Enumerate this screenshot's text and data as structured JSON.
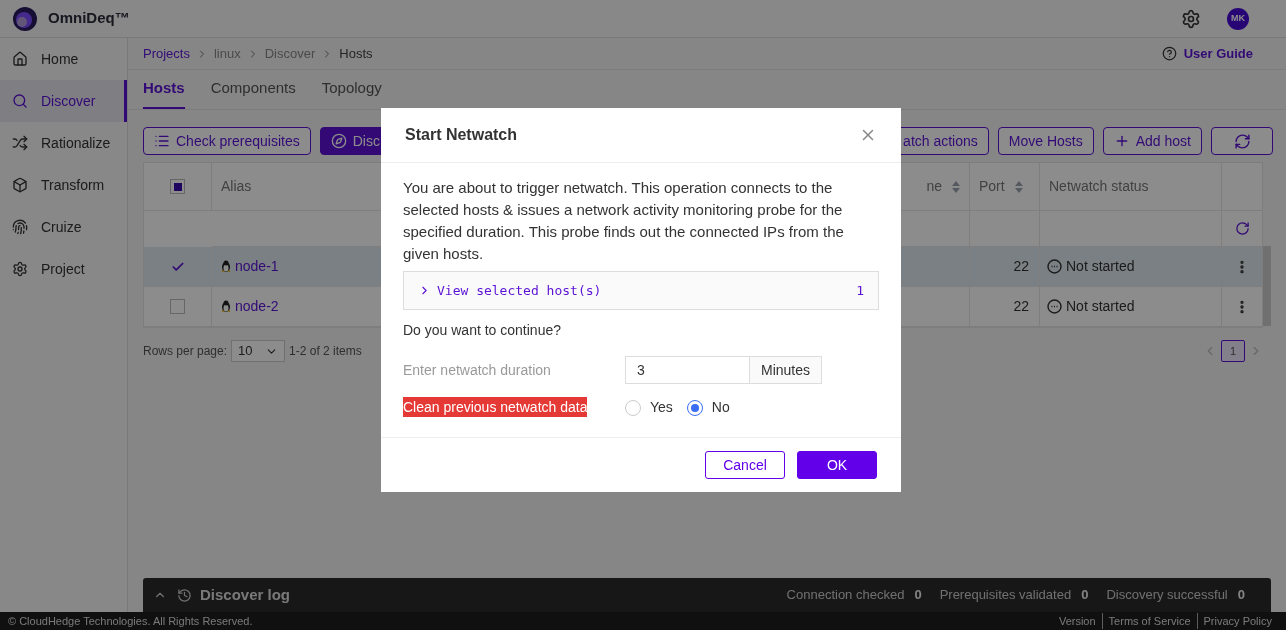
{
  "app": {
    "name": "OmniDeq™"
  },
  "header": {
    "avatar": "MK"
  },
  "sidebar": {
    "items": [
      {
        "label": "Home",
        "selected": false
      },
      {
        "label": "Discover",
        "selected": true
      },
      {
        "label": "Rationalize",
        "selected": false
      },
      {
        "label": "Transform",
        "selected": false
      },
      {
        "label": "Cruize",
        "selected": false
      },
      {
        "label": "Project",
        "selected": false
      }
    ]
  },
  "breadcrumb": [
    "Projects",
    "linux",
    "Discover",
    "Hosts"
  ],
  "user_guide": "User Guide",
  "tabs": [
    {
      "label": "Hosts",
      "selected": true
    },
    {
      "label": "Components",
      "selected": false
    },
    {
      "label": "Topology",
      "selected": false
    }
  ],
  "toolbar_left": [
    {
      "label": "Check prerequisites",
      "kind": "outline"
    },
    {
      "label": "Disc",
      "kind": "filled"
    }
  ],
  "toolbar_right": [
    {
      "label": "atch actions",
      "kind": "outline"
    },
    {
      "label": "Move Hosts",
      "kind": "outline"
    },
    {
      "label": "Add host",
      "kind": "outline"
    },
    {
      "kind": "icon"
    }
  ],
  "table": {
    "select_all_indeterminate": true,
    "columns": [
      {
        "label": "Alias",
        "sortable": false
      },
      {
        "label": "ne",
        "sortable": true
      },
      {
        "label": "Port",
        "sortable": true
      },
      {
        "label": "Netwatch status",
        "sortable": false
      }
    ],
    "rows": [
      {
        "alias": "node-1",
        "port": "22",
        "status": "Not started",
        "selected": true
      },
      {
        "alias": "node-2",
        "port": "22",
        "status": "Not started",
        "selected": false
      }
    ]
  },
  "pagination": {
    "rows_per_page_label": "Rows per page:",
    "rows_per_page": "10",
    "range": "1-2 of 2 items",
    "pages": [
      {
        "label": "1",
        "selected": true
      }
    ]
  },
  "log_bar": {
    "title": "Discover log",
    "stats": [
      {
        "label": "Connection checked",
        "value": "0"
      },
      {
        "label": "Prerequisites validated",
        "value": "0"
      },
      {
        "label": "Discovery successful",
        "value": "0"
      }
    ]
  },
  "footer": {
    "copyright": "© CloudHedge Technologies. All Rights Reserved.",
    "links": [
      "Version",
      "Terms of Service",
      "Privacy Policy"
    ]
  },
  "dialog": {
    "title": "Start Netwatch",
    "message": "You are about to trigger netwatch. This operation connects to the selected hosts & issues a network activity monitoring probe for the specified duration. This probe finds out the connected IPs from the given hosts.",
    "hosts_panel": {
      "label": "View selected host(s)",
      "count": "1",
      "expanded": false
    },
    "question": "Do you want to continue?",
    "duration": {
      "label": "Enter netwatch duration",
      "value": "3",
      "unit": "Minutes"
    },
    "clean": {
      "label": "Clean previous netwatch data",
      "options": [
        {
          "label": "Yes",
          "selected": false
        },
        {
          "label": "No",
          "selected": true
        }
      ]
    },
    "buttons": [
      {
        "label": "Cancel",
        "kind": "secondary"
      },
      {
        "label": "OK",
        "kind": "primary"
      }
    ]
  }
}
